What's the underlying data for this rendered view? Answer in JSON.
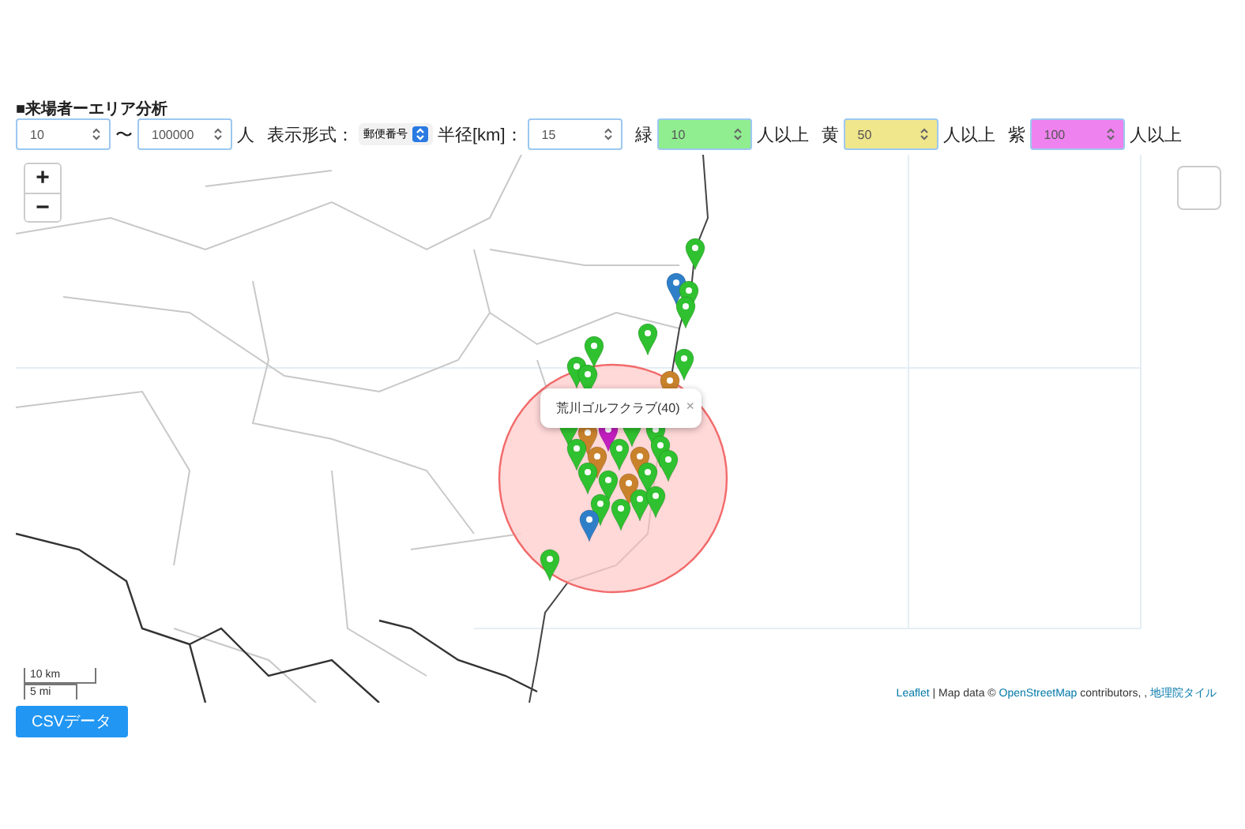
{
  "title": "■来場者ーエリア分析",
  "filters": {
    "min": "10",
    "range_sep": "〜",
    "max": "100000",
    "unit": "人",
    "format_label": "表示形式：",
    "format": "郵便番号",
    "radius_label": "半径[km]：",
    "radius": "15"
  },
  "thresholds": [
    {
      "label": "緑",
      "value": "10",
      "suffix": "人以上",
      "color": "#90ee90"
    },
    {
      "label": "黄",
      "value": "50",
      "suffix": "人以上",
      "color": "#f0e68c"
    },
    {
      "label": "紫",
      "value": "100",
      "suffix": "人以上",
      "color": "#ee82ee"
    }
  ],
  "map": {
    "zoom_in": "+",
    "zoom_out": "−",
    "popup": {
      "text": "荒川ゴルフクラブ(40)",
      "close": "×"
    },
    "scale": [
      "10 km",
      "5 mi"
    ],
    "attribution": [
      {
        "text": "Leaflet",
        "link": true
      },
      {
        "text": " | Map data © ",
        "link": false
      },
      {
        "text": "OpenStreetMap",
        "link": true
      },
      {
        "text": " contributors, , ",
        "link": false
      },
      {
        "text": "地理院タイル",
        "link": true
      }
    ]
  },
  "csv_button": "CSVデータ"
}
